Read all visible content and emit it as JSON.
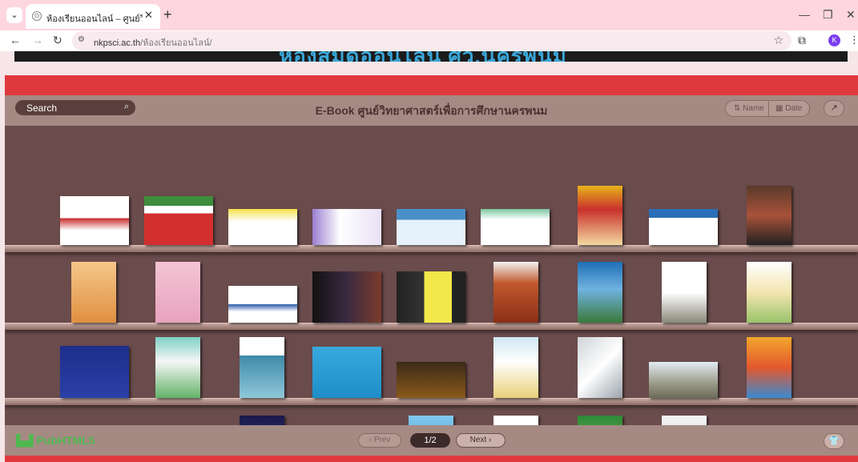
{
  "browser": {
    "tab_title": "ห้องเรียนออนไลน์ – ศูนย์วิทยาศาสต",
    "url_host": "nkpsci.ac.th",
    "url_path": "/ห้องเรียนออนไลน์/",
    "profile_initial": "K"
  },
  "page": {
    "banner_text": "ห้องสมุดออนไลน์ ศว.นครพนม",
    "search_placeholder": "Search",
    "shelf_title": "E-Book ศูนย์วิทยาศาสตร์เพื่อการศึกษานครพนม",
    "sort_name": "Name",
    "sort_date": "Date",
    "brand": "PubHTML5",
    "prev_label": "Prev",
    "next_label": "Next",
    "page_indicator": "1/2",
    "book_count_visible": 36
  },
  "colors": {
    "accent": "#e0393d",
    "shelf": "#6b4c4d",
    "brand_green": "#4fb84f"
  }
}
